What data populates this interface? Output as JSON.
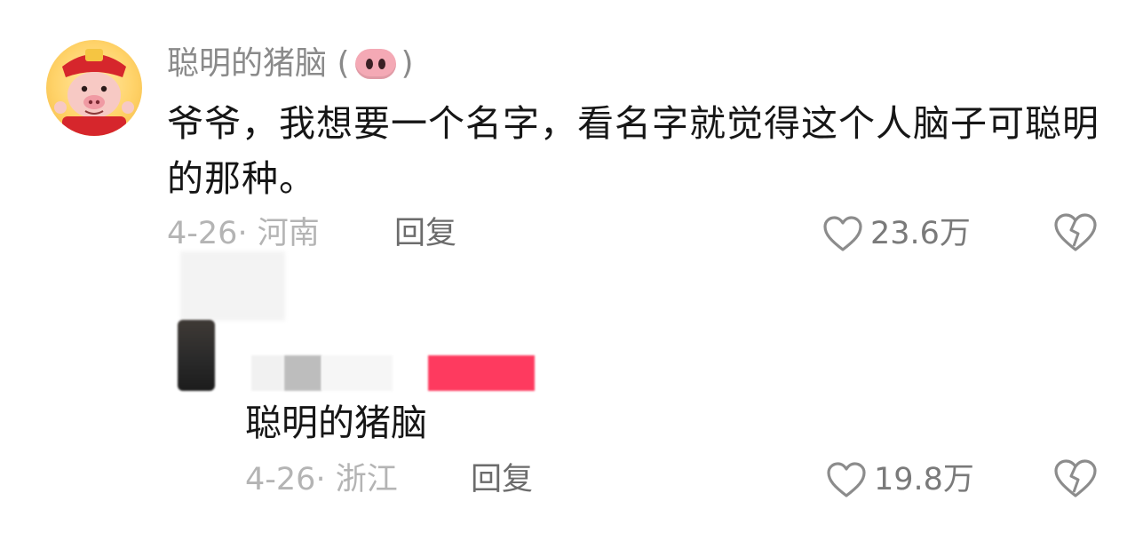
{
  "comments": [
    {
      "username": "聪明的猪脑",
      "username_suffix_icon": "pig-nose-emoji",
      "text": "爷爷，我想要一个名字，看名字就觉得这个人脑子可聪明的那种。",
      "date": "4-26",
      "location": "河南",
      "reply_label": "回复",
      "like_count": "23.6万",
      "like_icon": "heart-icon",
      "dislike_icon": "broken-heart-icon"
    },
    {
      "username": "",
      "text": "聪明的猪脑",
      "date": "4-26",
      "location": "浙江",
      "reply_label": "回复",
      "like_count": "19.8万",
      "like_icon": "heart-icon",
      "dislike_icon": "broken-heart-icon"
    }
  ],
  "colors": {
    "username": "#8a8a8a",
    "text": "#161616",
    "meta": "#b4b4b4",
    "reply": "#6c6c6c",
    "author_badge": "#fe2c55"
  }
}
